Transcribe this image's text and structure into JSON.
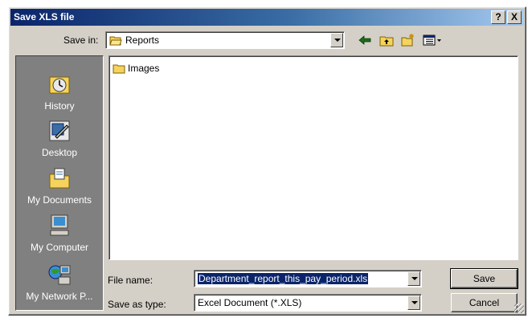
{
  "window": {
    "title": "Save XLS file",
    "help_label": "?",
    "close_label": "X"
  },
  "save_in": {
    "label": "Save in:",
    "value": "Reports",
    "icon": "folder-open-icon"
  },
  "toolbar": {
    "back": "back-arrow-icon",
    "up": "up-folder-icon",
    "new_folder": "new-folder-icon",
    "view_menu": "view-menu-icon"
  },
  "places": [
    {
      "label": "History",
      "icon": "history-icon"
    },
    {
      "label": "Desktop",
      "icon": "desktop-icon"
    },
    {
      "label": "My Documents",
      "icon": "my-documents-icon"
    },
    {
      "label": "My Computer",
      "icon": "my-computer-icon"
    },
    {
      "label": "My Network P...",
      "icon": "network-places-icon"
    }
  ],
  "files": [
    {
      "name": "Images",
      "icon": "folder-icon"
    }
  ],
  "file_name": {
    "label": "File name:",
    "value": "Department_report_this_pay_period.xls"
  },
  "save_as_type": {
    "label": "Save as type:",
    "value": "Excel Document (*.XLS)"
  },
  "buttons": {
    "save": "Save",
    "cancel": "Cancel"
  },
  "colors": {
    "titlebar_start": "#0a246a",
    "titlebar_end": "#a6caf0",
    "face": "#d4d0c8",
    "places_bg": "#808080",
    "selection": "#0a246a"
  }
}
